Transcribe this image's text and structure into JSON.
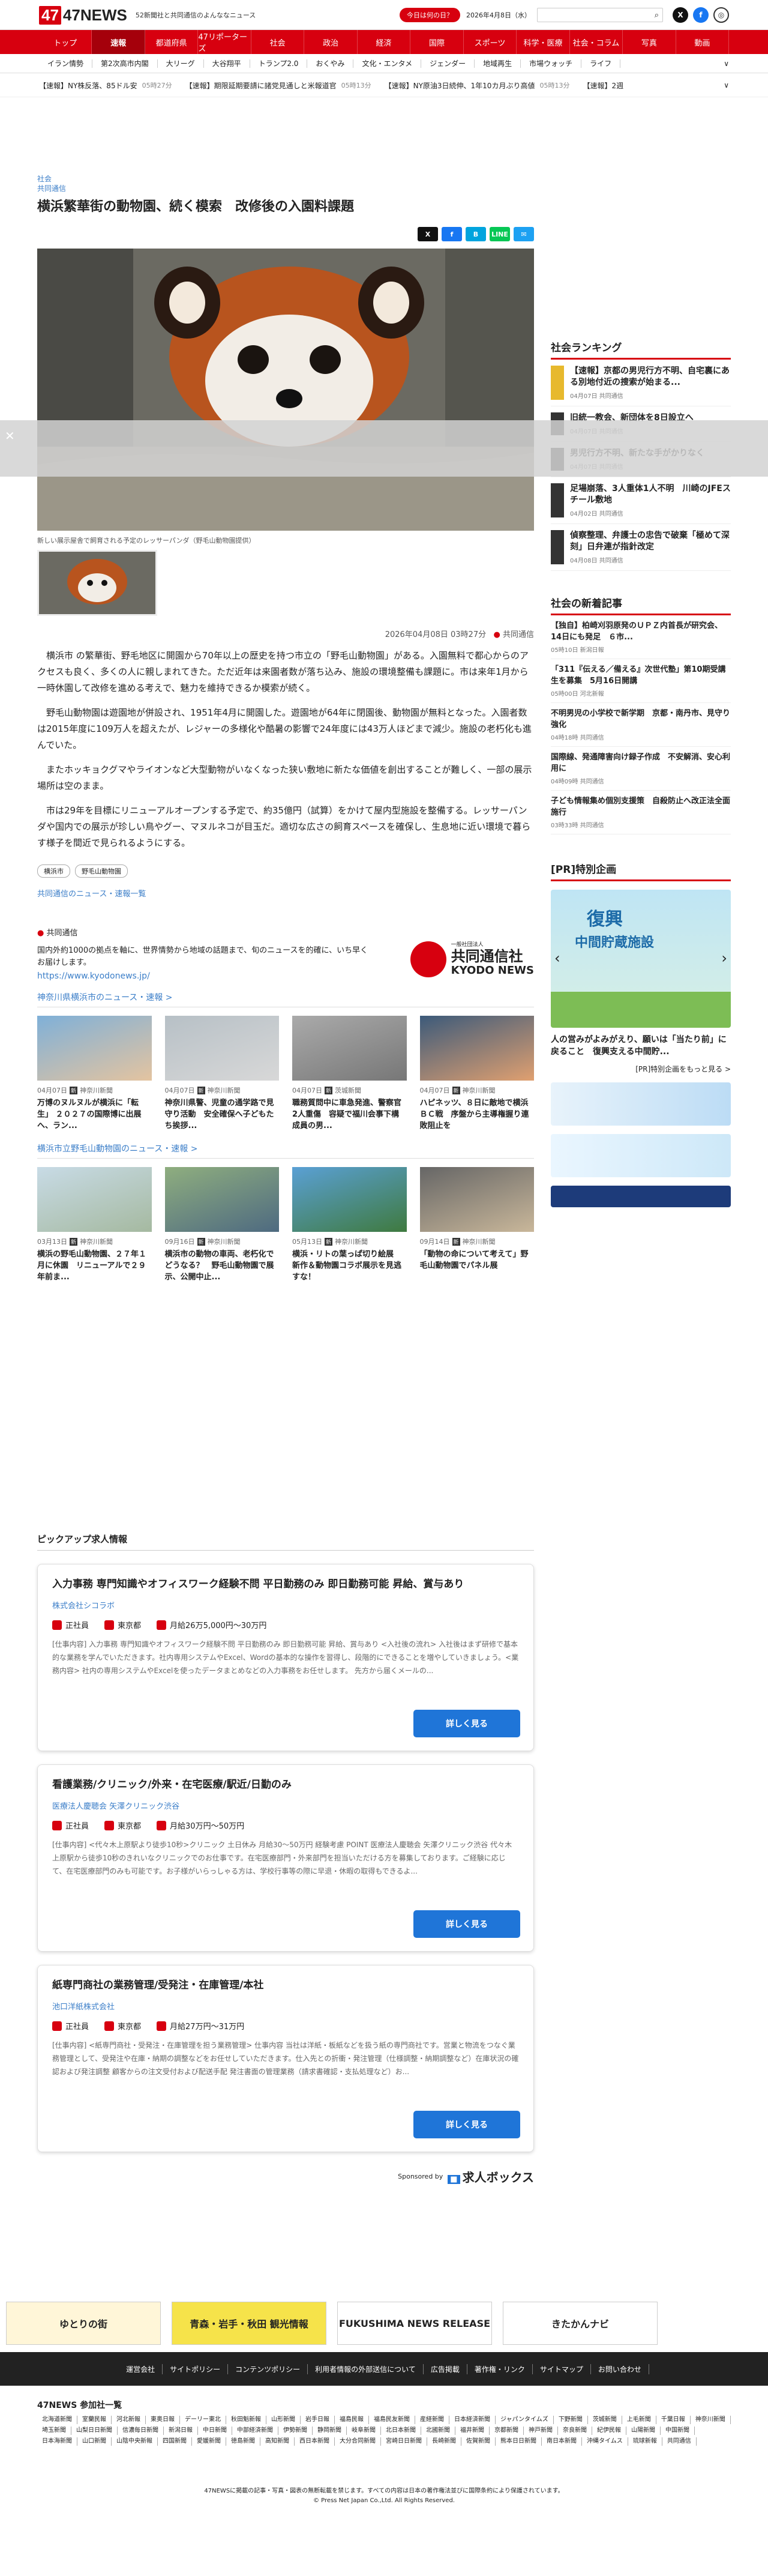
{
  "header": {
    "logo": "47NEWS",
    "tagline": "52新聞社と共同通信のよんななニュース",
    "today_btn": "今日は何の日？",
    "date": "2026年4月8日（水）",
    "search_placeholder": ""
  },
  "nav": [
    "トップ",
    "速報",
    "都道府県",
    "47リポーターズ",
    "社会",
    "政治",
    "経済",
    "国際",
    "スポーツ",
    "科学・医療",
    "社会・コラム",
    "写真",
    "動画"
  ],
  "subnav": [
    "イラン情勢",
    "第2次高市内閣",
    "大リーグ",
    "大谷翔平",
    "トランプ2.0",
    "おくやみ",
    "文化・エンタメ",
    "ジェンダー",
    "地域再生",
    "市場ウォッチ",
    "ライフ"
  ],
  "subnav_more": "∨",
  "flash": [
    {
      "label": "【速報】NY株反落、85ドル安",
      "time": "05時27分"
    },
    {
      "label": "【速報】期限延期要請に諸党見通しと米報道官",
      "time": "05時13分"
    },
    {
      "label": "【速報】NY原油3日続伸、1年10カ月ぶり高値",
      "time": "05時13分"
    },
    {
      "label": "【速報】2週",
      "time": ""
    }
  ],
  "flash_more": "∨",
  "article": {
    "category": "社会",
    "source": "共同通信",
    "title": "横浜繁華街の動物園、続く模索　改修後の入園料課題",
    "caption": "新しい展示屋舎で飼育される予定のレッサーパンダ（野毛山動物園提供）",
    "datetime": "2026年04月08日 03時27分",
    "byline": "共同通信",
    "paragraphs": [
      "横浜市 の繁華街、野毛地区に開園から70年以上の歴史を持つ市立の「野毛山動物園」がある。入園無料で都心からのアクセスも良く、多くの人に親しまれてきた。ただ近年は来園者数が落ち込み、施設の環境整備も課題に。市は来年1月から一時休園して改修を進める考えで、魅力を維持できるか模索が続く。",
      "野毛山動物園は遊園地が併設され、1951年4月に開園した。遊園地が64年に閉園後、動物園が無料となった。入園者数は2015年度に109万人を超えたが、レジャーの多様化や酷暑の影響で24年度には43万人ほどまで減少。施設の老朽化も進んでいた。",
      "またホッキョクグマやライオンなど大型動物がいなくなった狭い敷地に新たな価値を創出することが難しく、一部の展示場所は空のまま。",
      "市は29年を目標にリニューアルオープンする予定で、約35億円（試算）をかけて屋内型施設を整備する。レッサーパンダや国内での展示が珍しい鳥やグー、マヌルネコが目玉だ。適切な広さの飼育スペースを確保し、生息地に近い環境で暮らす様子を間近で見られるようにする。"
    ],
    "tags": [
      "横浜市",
      "野毛山動物園"
    ],
    "more_link": "共同通信のニュース・速報一覧"
  },
  "share_buttons": [
    "X",
    "f",
    "B",
    "LINE",
    "✉"
  ],
  "kyodo": {
    "name": "共同通信",
    "desc": "国内外約1000の拠点を軸に、世界情勢から地域の話題まで、旬のニュースを的確に、いち早くお届けします。",
    "url": "https://www.kyodonews.jp/",
    "logo_small": "一般社団法人",
    "logo_big": "共同通信社",
    "logo_en": "KYODO NEWS"
  },
  "sections": [
    {
      "heading": "神奈川県横浜市のニュース・速報 >",
      "cards": [
        {
          "date": "04月07日",
          "src": "神奈川新聞",
          "title": "万博のヌルヌルが横浜に「転生」 ２０２７の国際博に出展へ、ラン..."
        },
        {
          "date": "04月07日",
          "src": "神奈川新聞",
          "title": "神奈川県警、児童の通学路で見守り活動　安全確保へ子どもたち挨拶..."
        },
        {
          "date": "04月07日",
          "src": "茨城新聞",
          "title": "職務質問中に車急発進、警察官2人重傷　容疑で福川会事下構成員の男..."
        },
        {
          "date": "04月07日",
          "src": "神奈川新聞",
          "title": "ハピネッツ、８日に敵地で横浜ＢＣ戦　序盤から主導権握り連敗阻止を"
        }
      ]
    },
    {
      "heading": "横浜市立野毛山動物園のニュース・速報 >",
      "cards": [
        {
          "date": "03月13日",
          "src": "神奈川新聞",
          "title": "横浜の野毛山動物園、２７年１月に休園　リニューアルで２９年前ま..."
        },
        {
          "date": "09月16日",
          "date2": "",
          "src": "神奈川新聞",
          "title": "横浜市の動物の車両、老朽化でどうなる？　野毛山動物園で展示、公開中止..."
        },
        {
          "date": "05月13日",
          "src": "神奈川新聞",
          "title": "横浜・リトの葉っぱ切り絵展　新作＆動物園コラボ展示を見逃すな！"
        },
        {
          "date": "09月14日",
          "src": "神奈川新聞",
          "title": "「動物の命について考えて」野毛山動物園でパネル展"
        }
      ]
    }
  ],
  "jobs": {
    "heading": "ピックアップ求人情報",
    "items": [
      {
        "title": "入力事務 専門知識やオフィスワーク経験不問 平日勤務のみ 即日勤務可能 昇給、賞与あり",
        "company": "株式会社シコラボ",
        "type": "正社員",
        "location": "東京都",
        "salary": "月給26万5,000円〜30万円",
        "desc": "[仕事内容] 入力事務 専門知識やオフィスワーク経験不問 平日勤務のみ 即日勤務可能 昇給、賞与あり <入社後の流れ> 入社後はまず研修で基本的な業務を学んでいただきます。社内専用システムやExcel、Wordの基本的な操作を習得し、段階的にできることを増やしていきましょう。<業務内容> 社内の専用システムやExcelを使ったデータまとめなどの入力事務をお任せします。 先方から届くメールの..."
      },
      {
        "title": "看護業務/クリニック/外来・在宅医療/駅近/日勤のみ",
        "company": "医療法人慶聴会 矢澤クリニック渋谷",
        "type": "正社員",
        "location": "東京都",
        "salary": "月給30万円〜50万円",
        "desc": "[仕事内容] <代々木上原駅より徒歩10秒>クリニック 土日休み 月給30〜50万円 経験考慮 POINT 医療法人慶聴会 矢澤クリニック渋谷 代々木上原駅から徒歩10秒のきれいなクリニックでのお仕事です。在宅医療部門・外来部門を担当いただける方を募集しております。ご経験に応じて、在宅医療部門のみも可能です。お子様がいらっしゃる方は、学校行事等の際に早退・休暇の取得もできるよ..."
      },
      {
        "title": "紙専門商社の業務管理/受発注・在庫管理/本社",
        "company": "池口洋紙株式会社",
        "type": "正社員",
        "location": "東京都",
        "salary": "月給27万円〜31万円",
        "desc": "[仕事内容] <紙専門商社・受発注・在庫管理を担う業務管理> 仕事内容 当社は洋紙・板紙などを扱う紙の専門商社です。営業と物流をつなぐ業務管理として、受発注や在庫・納期の調整などをお任せしていただきます。仕入先との折衝・発注管理（仕様調整・納期調整など）在庫状況の確認および発注調整 顧客からの注文受付および配送手配 発注書面の管理業務（請求書確認・支払処理など）お..."
      }
    ],
    "btn": "詳しく見る",
    "sponsored": "Sponsored by",
    "sponsor_logo": "求人ボックス"
  },
  "ranking": {
    "heading": "社会ランキング",
    "items": [
      {
        "title": "【速報】京都の男児行方不明、自宅裏にある別地付近の捜索が始まる...",
        "meta": "04月07日 共同通信",
        "gold": true
      },
      {
        "title": "旧統一教会、新団体を8日設立へ",
        "meta": "04月07日 共同通信",
        "gold": false
      },
      {
        "title": "男児行方不明、新たな手がかりなく",
        "meta": "04月07日 共同通信",
        "gold": false
      },
      {
        "title": "足場崩落、3人重体1人不明　川崎のJFEスチール敷地",
        "meta": "04月02日 共同通信",
        "gold": false
      },
      {
        "title": "偵察整理、弁護士の忠告で破棄「極めて深刻」日弁連が指針改定",
        "meta": "04月08日 共同通信",
        "gold": false
      }
    ]
  },
  "newest": {
    "heading": "社会の新着記事",
    "items": [
      {
        "title": "【独自】柏崎刈羽原発のＵＰＺ内首長が研究会、14日にも発足　６市...",
        "meta": "05時10日 新潟日報"
      },
      {
        "title": "「311『伝える／備える』次世代塾」第10期受講生を募集　5月16日開講",
        "meta": "05時00日 河北新報"
      },
      {
        "title": "不明男児の小学校で新学期　京都・南丹市、見守り強化",
        "meta": "04時18時 共同通信"
      },
      {
        "title": "国際線、発通障害向け録子作成　不安解消、安心利用に",
        "meta": "04時09時 共同通信"
      },
      {
        "title": "子ども情報集め個別支援策　自殺防止へ改正法全面施行",
        "meta": "03時33時 共同通信"
      }
    ]
  },
  "pr": {
    "heading": "[PR]特別企画",
    "banner_main": "復興",
    "banner_sub": "中間貯蔵施設",
    "text": "人の営みがよみがえり、願いは「当たり前」に戻ること　復興支える中間貯...",
    "more": "[PR]特別企画をもっと見る >"
  },
  "footer": {
    "banners": [
      "ゆとりの街",
      "青森・岩手・秋田 観光情報",
      "FUKUSHIMA NEWS RELEASE",
      "きたかんナビ"
    ],
    "nav": [
      "運営会社",
      "サイトポリシー",
      "コンテンツポリシー",
      "利用者情報の外部送信について",
      "広告掲載",
      "著作権・リンク",
      "サイトマップ",
      "お問い合わせ"
    ],
    "sites_heading": "47NEWS 参加社一覧",
    "sites": [
      "北海道新聞",
      "室蘭民報",
      "河北新報",
      "東奥日報",
      "デーリー東北",
      "秋田魁新報",
      "山形新聞",
      "岩手日報",
      "福島民報",
      "福島民友新聞",
      "産経新聞",
      "日本経済新聞",
      "ジャパンタイムズ",
      "下野新聞",
      "茨城新聞",
      "上毛新聞",
      "千葉日報",
      "神奈川新聞",
      "埼玉新聞",
      "山梨日日新聞",
      "信濃毎日新聞",
      "新潟日報",
      "中日新聞",
      "中部経済新聞",
      "伊勢新聞",
      "静岡新聞",
      "岐阜新聞",
      "北日本新聞",
      "北國新聞",
      "福井新聞",
      "京都新聞",
      "神戸新聞",
      "奈良新聞",
      "紀伊民報",
      "山陽新聞",
      "中国新聞",
      "日本海新聞",
      "山口新聞",
      "山陰中央新報",
      "四国新聞",
      "愛媛新聞",
      "徳島新聞",
      "高知新聞",
      "西日本新聞",
      "大分合同新聞",
      "宮崎日日新聞",
      "長崎新聞",
      "佐賀新聞",
      "熊本日日新聞",
      "南日本新聞",
      "沖縄タイムス",
      "琉球新報",
      "共同通信"
    ],
    "copy1": "47NEWSに掲載の記事・写真・図表の無断転載を禁じます。すべての内容は日本の著作権法並びに国際条約により保護されています。",
    "copy2": "© Press Net Japan Co.,Ltd. All Rights Reserved."
  },
  "overlay_close": "✕"
}
